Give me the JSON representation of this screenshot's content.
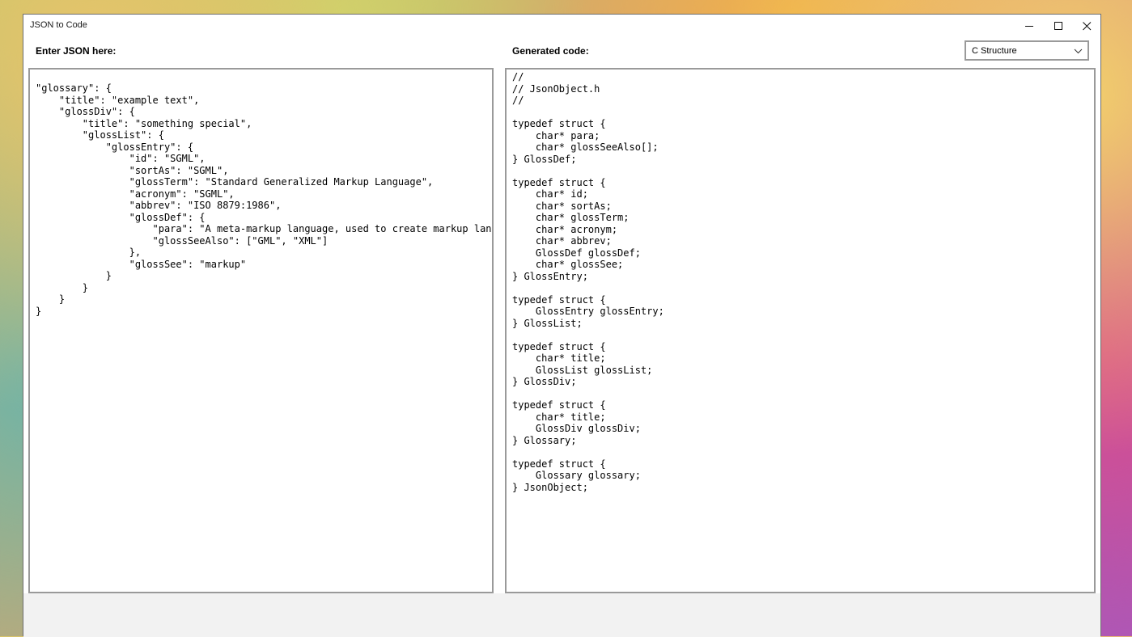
{
  "window": {
    "title": "JSON to Code"
  },
  "input_panel": {
    "label": "Enter JSON here:",
    "content": "\"glossary\": {\n    \"title\": \"example text\",\n    \"glossDiv\": {\n        \"title\": \"something special\",\n        \"glossList\": {\n            \"glossEntry\": {\n                \"id\": \"SGML\",\n                \"sortAs\": \"SGML\",\n                \"glossTerm\": \"Standard Generalized Markup Language\",\n                \"acronym\": \"SGML\",\n                \"abbrev\": \"ISO 8879:1986\",\n                \"glossDef\": {\n                    \"para\": \"A meta-markup language, used to create markup languag\n                    \"glossSeeAlso\": [\"GML\", \"XML\"]\n                },\n                \"glossSee\": \"markup\"\n            }\n        }\n    }\n}"
  },
  "output_panel": {
    "label": "Generated code:",
    "language": {
      "selected": "C Structure"
    },
    "content": "//\n// JsonObject.h\n//\n\ntypedef struct {\n    char* para;\n    char* glossSeeAlso[];\n} GlossDef;\n\ntypedef struct {\n    char* id;\n    char* sortAs;\n    char* glossTerm;\n    char* acronym;\n    char* abbrev;\n    GlossDef glossDef;\n    char* glossSee;\n} GlossEntry;\n\ntypedef struct {\n    GlossEntry glossEntry;\n} GlossList;\n\ntypedef struct {\n    char* title;\n    GlossList glossList;\n} GlossDiv;\n\ntypedef struct {\n    char* title;\n    GlossDiv glossDiv;\n} Glossary;\n\ntypedef struct {\n    Glossary glossary;\n} JsonObject;"
  },
  "icons": {
    "minimize": "minimize-icon",
    "maximize": "maximize-icon",
    "close": "close-icon",
    "dropdown": "chevron-down-icon"
  }
}
